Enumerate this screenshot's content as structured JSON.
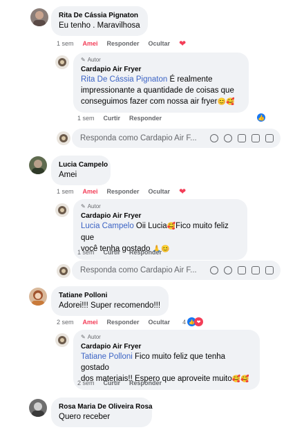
{
  "comments": [
    {
      "name": "Rita De Cássia Pignaton",
      "text": "Eu tenho . Maravilhosa",
      "time": "1 sem",
      "reaction": "Amei",
      "reply_label": "Responder",
      "hide_label": "Ocultar",
      "reply": {
        "author_badge": "Autor",
        "name": "Cardapio Air Fryer",
        "mention": "Rita De Cássia Pignaton",
        "text_line1": " É realmente",
        "text_line2": "impressionante a quantidade de coisas que",
        "text_line3": "conseguimos fazer com nossa air fryer",
        "emoji": "😊🥰",
        "time": "1 sem",
        "like_label": "Curtir",
        "reply_label": "Responder"
      }
    },
    {
      "name": "Lucia Campelo",
      "text": "Amei",
      "time": "1 sem",
      "reaction": "Amei",
      "reply_label": "Responder",
      "hide_label": "Ocultar",
      "reply": {
        "author_badge": "Autor",
        "name": "Cardapio Air Fryer",
        "mention": "Lucia Campelo",
        "text_line1": " Oii Lucia",
        "emoji1": "🥰",
        "text_line1b": "Fico muito feliz que",
        "text_line2": "você tenha gostado ",
        "emoji2": "🙏😊",
        "time": "1 sem",
        "like_label": "Curtir",
        "reply_label": "Responder"
      }
    },
    {
      "name": "Tatiane Polloni",
      "text": "Adorei!!! Super recomendo!!!",
      "time": "2 sem",
      "reaction": "Amei",
      "reply_label": "Responder",
      "hide_label": "Ocultar",
      "reaction_count": "4",
      "reply": {
        "author_badge": "Autor",
        "name": "Cardapio Air Fryer",
        "mention": "Tatiane Polloni",
        "text_line1": " Fico muito feliz que tenha gostado",
        "text_line2": "dos materiais!! Espero que aproveite muito",
        "emoji": "🥰🥰",
        "time": "2 sem",
        "like_label": "Curtir",
        "reply_label": "Responder"
      }
    },
    {
      "name": "Rosa Maria De Oliveira Rosa",
      "text": "Quero receber"
    }
  ],
  "reply_box": {
    "placeholder": "Responda como Cardapio Air F..."
  },
  "colors": {
    "bubble": "#f0f2f5",
    "mention": "#3b63c4",
    "love": "#f33e58",
    "like": "#1877f2"
  },
  "icons": [
    "pencil-icon",
    "heart-reaction-icon",
    "like-reaction-icon",
    "emoji-icon",
    "camera-icon",
    "gif-icon",
    "sticker-icon",
    "avatar-icon"
  ]
}
